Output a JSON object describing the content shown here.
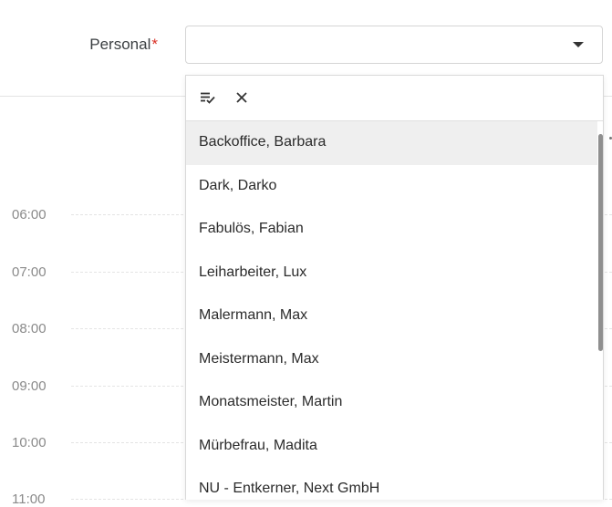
{
  "form": {
    "label": "Personal",
    "required_mark": "*",
    "selected_value": ""
  },
  "calendar": {
    "times": [
      "06:00",
      "07:00",
      "08:00",
      "09:00",
      "10:00",
      "11:00"
    ]
  },
  "dropdown": {
    "toolbar": {
      "select_all_icon": "select-all-icon",
      "clear_icon": "close-icon"
    },
    "options": [
      "Backoffice, Barbara",
      "Dark, Darko",
      "Fabulös, Fabian",
      "Leiharbeiter, Lux",
      "Malermann, Max",
      "Meistermann, Max",
      "Monatsmeister, Martin",
      "Mürbefrau, Madita",
      "NU - Entkerner, Next GmbH"
    ],
    "highlighted_index": 0
  },
  "colors": {
    "required": "#d93025",
    "highlight": "#efefef",
    "scrollbar": "#8f8f8f"
  }
}
